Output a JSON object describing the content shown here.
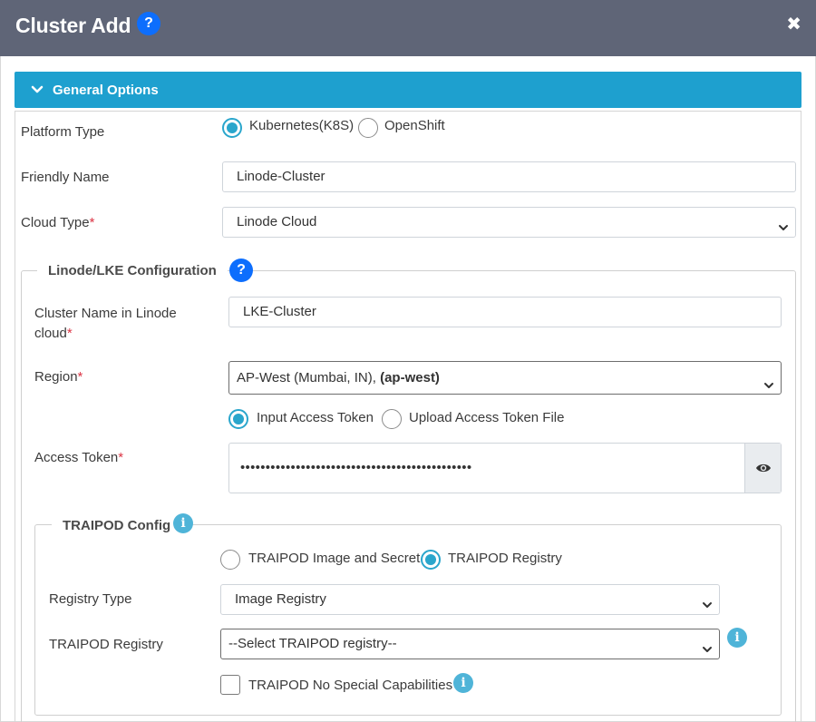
{
  "dialog": {
    "title": "Cluster Add",
    "help_glyph": "?",
    "close_glyph": "✖"
  },
  "section": {
    "title": "General Options",
    "expanded": true
  },
  "form": {
    "platform_type": {
      "label": "Platform Type",
      "options": [
        "Kubernetes(K8S)",
        "OpenShift"
      ],
      "selected": "Kubernetes(K8S)"
    },
    "friendly_name": {
      "label": "Friendly Name",
      "value": "Linode-Cluster"
    },
    "cloud_type": {
      "label": "Cloud Type",
      "required_mark": "*",
      "value": "Linode Cloud"
    }
  },
  "linode_config": {
    "legend": "Linode/LKE Configuration",
    "help_glyph": "?",
    "cluster_name": {
      "label": "Cluster Name in Linode cloud",
      "required_mark": "*",
      "value": "LKE-Cluster"
    },
    "region": {
      "label": "Region",
      "required_mark": "*",
      "value_prefix": "AP-West (Mumbai, IN),",
      "value_code": "(ap-west)"
    },
    "token_source": {
      "options": [
        "Input Access Token",
        "Upload Access Token File"
      ],
      "selected": "Input Access Token"
    },
    "access_token": {
      "label": "Access Token",
      "required_mark": "*",
      "masked_value": "••••••••••••••••••••••••••••••••••••••••••••••"
    }
  },
  "traipod_config": {
    "legend": "TRAIPOD Config",
    "info_glyph": "i",
    "source": {
      "options": [
        "TRAIPOD Image and Secret",
        "TRAIPOD Registry"
      ],
      "selected": "TRAIPOD Registry"
    },
    "registry_type": {
      "label": "Registry Type",
      "value": "Image Registry"
    },
    "registry": {
      "label": "TRAIPOD Registry",
      "value": "--Select TRAIPOD registry--"
    },
    "no_special_caps": {
      "label": "TRAIPOD No Special Capabilities",
      "checked": false
    }
  },
  "colors": {
    "title_bar": "#5f6577",
    "section_header": "#1ea0cf",
    "radio_accent": "#2aa6cc",
    "help_badge": "#0d6efd",
    "info_badge": "#4fb4d8",
    "required": "#dc3545"
  },
  "icons": {
    "help": "question-circle-icon",
    "close": "close-icon",
    "expand": "chevron-down-icon",
    "password_visibility": "eye-icon",
    "info": "info-circle-icon"
  }
}
